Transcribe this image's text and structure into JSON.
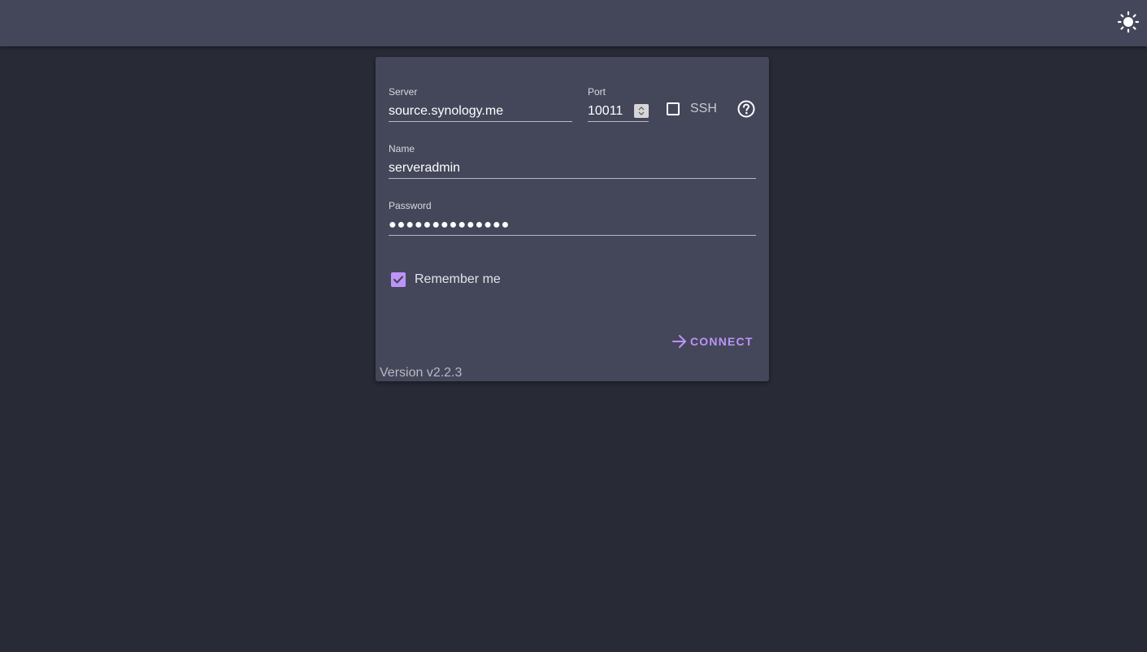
{
  "header": {
    "theme_icon": "sun-icon"
  },
  "login": {
    "server_label": "Server",
    "server_value": "source.synology.me",
    "port_label": "Port",
    "port_value": "10011",
    "ssh_label": "SSH",
    "ssh_checked": false,
    "help_icon": "help-circle-icon",
    "name_label": "Name",
    "name_value": "serveradmin",
    "password_label": "Password",
    "password_value": "●●●●●●●●●●●●●●",
    "remember_label": "Remember me",
    "remember_checked": true,
    "connect_label": "CONNECT",
    "connect_icon": "arrow-right-icon",
    "version": "Version v2.2.3"
  },
  "colors": {
    "background": "#282a36",
    "surface": "#44475a",
    "accent": "#bd93f9"
  }
}
